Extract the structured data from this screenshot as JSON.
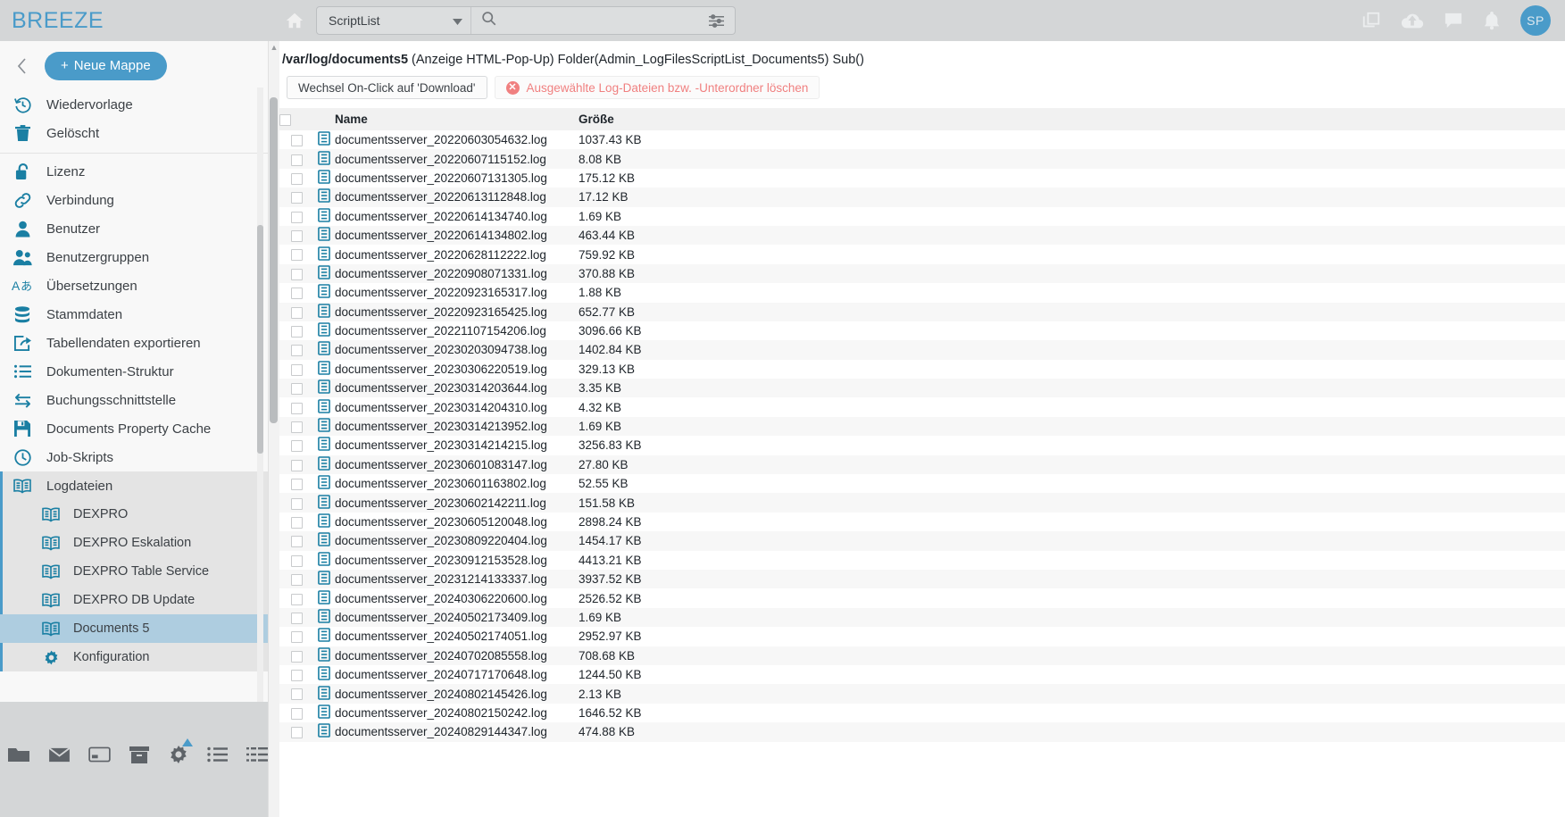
{
  "topbar": {
    "brand": "BREEZE",
    "home_icon": "home-icon",
    "script_select_value": "ScriptList",
    "search_placeholder": "",
    "search_value": "",
    "icons": [
      "window-copy-icon",
      "cloud-upload-icon",
      "chat-icon",
      "bell-icon"
    ],
    "avatar_initials": "SP",
    "accent_color": "#4a9bc9"
  },
  "sidebar": {
    "collapse_label": "‹",
    "new_folder_label": "Neue Mappe",
    "items": [
      {
        "label": "Wiedervorlage",
        "icon": "history-clock-icon",
        "level": 0
      },
      {
        "label": "Gelöscht",
        "icon": "trash-icon",
        "level": 0
      },
      {
        "label": "Lizenz",
        "icon": "lock-open-icon",
        "level": 0
      },
      {
        "label": "Verbindung",
        "icon": "link-icon",
        "level": 0
      },
      {
        "label": "Benutzer",
        "icon": "user-icon",
        "level": 0
      },
      {
        "label": "Benutzergruppen",
        "icon": "users-icon",
        "level": 0
      },
      {
        "label": "Übersetzungen",
        "icon": "translate-icon",
        "level": 0
      },
      {
        "label": "Stammdaten",
        "icon": "database-icon",
        "level": 0
      },
      {
        "label": "Tabellendaten exportieren",
        "icon": "export-icon",
        "level": 0
      },
      {
        "label": "Dokumenten-Struktur",
        "icon": "list-icon",
        "level": 0
      },
      {
        "label": "Buchungsschnittstelle",
        "icon": "exchange-icon",
        "level": 0
      },
      {
        "label": "Documents Property Cache",
        "icon": "save-disk-icon",
        "level": 0
      },
      {
        "label": "Job-Skripts",
        "icon": "clock-icon",
        "level": 0
      },
      {
        "label": "Logdateien",
        "icon": "book-icon",
        "level": 0,
        "group": true
      },
      {
        "label": "DEXPRO",
        "icon": "book-icon",
        "level": 1,
        "group": true
      },
      {
        "label": "DEXPRO Eskalation",
        "icon": "book-icon",
        "level": 1,
        "group": true
      },
      {
        "label": "DEXPRO Table Service",
        "icon": "book-icon",
        "level": 1,
        "group": true
      },
      {
        "label": "DEXPRO DB Update",
        "icon": "book-icon",
        "level": 1,
        "group": true
      },
      {
        "label": "Documents 5",
        "icon": "book-icon",
        "level": 1,
        "selected": true
      },
      {
        "label": "Konfiguration",
        "icon": "gear-icon",
        "level": 1,
        "group": true
      }
    ]
  },
  "bottom_toolbar": {
    "icons": [
      "folder-icon",
      "envelope-icon",
      "card-icon",
      "archive-icon",
      "gear-icon",
      "list-icon",
      "list-detail-icon"
    ],
    "gear_badge_color": "#4a9bc9"
  },
  "main": {
    "breadcrumb_path": "/var/log/documents5",
    "breadcrumb_rest": " (Anzeige HTML-Pop-Up) Folder(Admin_LogFilesScriptList_Documents5) Sub()",
    "buttons": {
      "toggle_download_label": "Wechsel On-Click auf 'Download'",
      "delete_label": "Ausgewählte Log-Dateien bzw. -Unterordner löschen",
      "delete_color": "#f08080"
    },
    "table": {
      "columns": [
        "",
        "",
        "Name",
        "Größe",
        ""
      ],
      "rows": [
        {
          "name": "documentsserver_20220603054632.log",
          "size": "1037.43 KB"
        },
        {
          "name": "documentsserver_20220607115152.log",
          "size": "8.08 KB"
        },
        {
          "name": "documentsserver_20220607131305.log",
          "size": "175.12 KB"
        },
        {
          "name": "documentsserver_20220613112848.log",
          "size": "17.12 KB"
        },
        {
          "name": "documentsserver_20220614134740.log",
          "size": "1.69 KB"
        },
        {
          "name": "documentsserver_20220614134802.log",
          "size": "463.44 KB"
        },
        {
          "name": "documentsserver_20220628112222.log",
          "size": "759.92 KB"
        },
        {
          "name": "documentsserver_20220908071331.log",
          "size": "370.88 KB"
        },
        {
          "name": "documentsserver_20220923165317.log",
          "size": "1.88 KB"
        },
        {
          "name": "documentsserver_20220923165425.log",
          "size": "652.77 KB"
        },
        {
          "name": "documentsserver_20221107154206.log",
          "size": "3096.66 KB"
        },
        {
          "name": "documentsserver_20230203094738.log",
          "size": "1402.84 KB"
        },
        {
          "name": "documentsserver_20230306220519.log",
          "size": "329.13 KB"
        },
        {
          "name": "documentsserver_20230314203644.log",
          "size": "3.35 KB"
        },
        {
          "name": "documentsserver_20230314204310.log",
          "size": "4.32 KB"
        },
        {
          "name": "documentsserver_20230314213952.log",
          "size": "1.69 KB"
        },
        {
          "name": "documentsserver_20230314214215.log",
          "size": "3256.83 KB"
        },
        {
          "name": "documentsserver_20230601083147.log",
          "size": "27.80 KB"
        },
        {
          "name": "documentsserver_20230601163802.log",
          "size": "52.55 KB"
        },
        {
          "name": "documentsserver_20230602142211.log",
          "size": "151.58 KB"
        },
        {
          "name": "documentsserver_20230605120048.log",
          "size": "2898.24 KB"
        },
        {
          "name": "documentsserver_20230809220404.log",
          "size": "1454.17 KB"
        },
        {
          "name": "documentsserver_20230912153528.log",
          "size": "4413.21 KB"
        },
        {
          "name": "documentsserver_20231214133337.log",
          "size": "3937.52 KB"
        },
        {
          "name": "documentsserver_20240306220600.log",
          "size": "2526.52 KB"
        },
        {
          "name": "documentsserver_20240502173409.log",
          "size": "1.69 KB"
        },
        {
          "name": "documentsserver_20240502174051.log",
          "size": "2952.97 KB"
        },
        {
          "name": "documentsserver_20240702085558.log",
          "size": "708.68 KB"
        },
        {
          "name": "documentsserver_20240717170648.log",
          "size": "1244.50 KB"
        },
        {
          "name": "documentsserver_20240802145426.log",
          "size": "2.13 KB"
        },
        {
          "name": "documentsserver_20240802150242.log",
          "size": "1646.52 KB"
        },
        {
          "name": "documentsserver_20240829144347.log",
          "size": "474.88 KB"
        }
      ]
    }
  }
}
